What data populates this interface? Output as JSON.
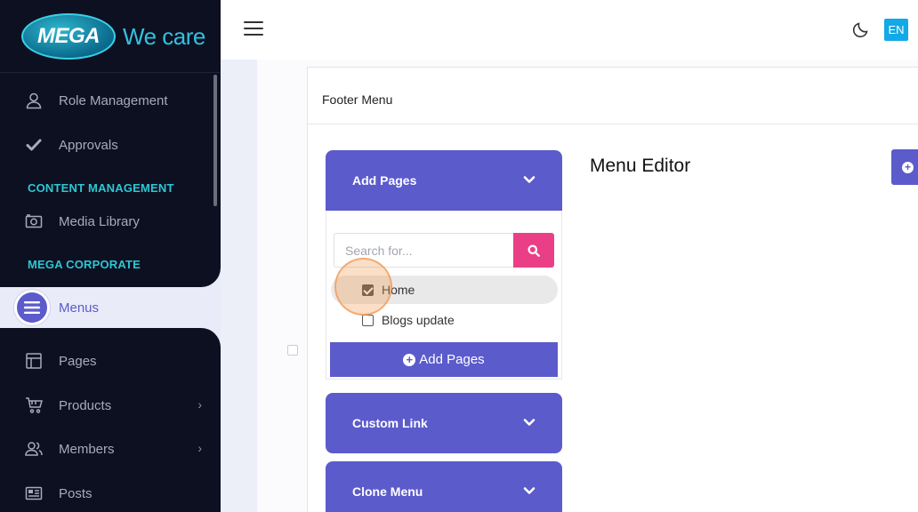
{
  "brand": {
    "logo_text": "MEGA",
    "tagline": "We care"
  },
  "sidebar": {
    "items": [
      {
        "label": "Role Management",
        "icon": "user-icon"
      },
      {
        "label": "Approvals",
        "icon": "check-icon"
      }
    ],
    "section_content": "CONTENT MANAGEMENT",
    "media_library": "Media Library",
    "section_corporate": "MEGA CORPORATE",
    "menus": "Menus",
    "pages": "Pages",
    "products": "Products",
    "members": "Members",
    "posts": "Posts"
  },
  "header": {
    "language": "EN"
  },
  "main": {
    "card_title": "Footer Menu",
    "add_pages_header": "Add Pages",
    "search_placeholder": "Search for...",
    "options": [
      {
        "label": "Home",
        "checked": true
      },
      {
        "label": "Blogs update",
        "checked": false
      }
    ],
    "add_pages_button": "Add Pages",
    "custom_link_header": "Custom Link",
    "clone_menu_header": "Clone Menu",
    "editor_title": "Menu Editor"
  },
  "colors": {
    "accent": "#5b5bcc",
    "search": "#ea3f86",
    "sidebar_bg": "#0d1021",
    "section": "#2ec7d3",
    "lang": "#13a9e6"
  }
}
